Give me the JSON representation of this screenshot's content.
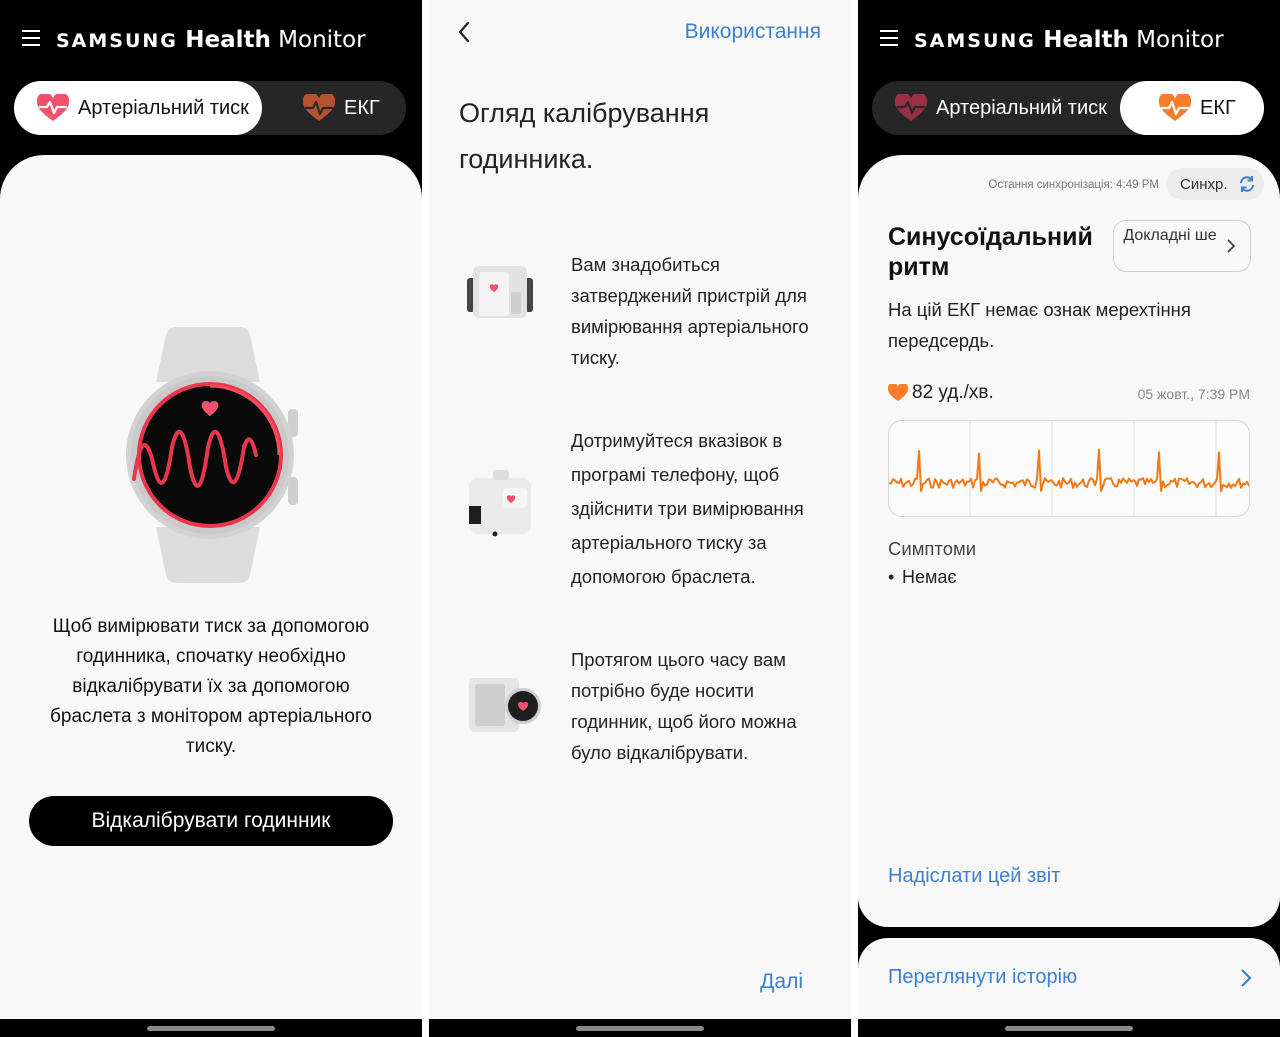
{
  "brand": {
    "part1": "SAMSUNG",
    "part2": "Health",
    "part3": "Monitor"
  },
  "tabs": {
    "bp": "Артеріальний тиск",
    "ecg": "ЕКГ"
  },
  "colors": {
    "link": "#3d7fd1",
    "ecg_line": "#f07a17",
    "heart": "#f26a4b"
  },
  "screen1": {
    "description": "Щоб вимірювати тиск за допомогою годинника, спочатку необхідно відкалібрувати їх за допомогою браслета з монітором артеріального тиску.",
    "calibrate_button": "Відкалібрувати годинник"
  },
  "screen2": {
    "top_link": "Використання",
    "title": "Огляд калібрування годинника.",
    "steps": [
      {
        "icon": "bp-monitor-icon",
        "text": "Вам знадобиться затверджений пристрій для вимірювання артеріального тиску."
      },
      {
        "icon": "phone-cuff-icon",
        "text": "Дотримуйтеся вказівок в програмі телефону, щоб здійснити три вимірювання артеріального тиску за допомогою браслета."
      },
      {
        "icon": "watch-calibration-icon",
        "text": "Протягом цього часу вам потрібно буде носити годинник, щоб його можна було відкалібрувати."
      }
    ],
    "next": "Далі"
  },
  "screen3": {
    "last_sync": "Остання синхронізація: 4:49 PM",
    "sync_button": "Синхр.",
    "result_title": "Синусоїдальний ритм",
    "details_button": "Докладні ше",
    "result_desc": "На цій ЕКГ немає ознак мерехтіння передсердь.",
    "bpm": "82 уд./хв.",
    "date": "05 жовт., 7:39 PM",
    "symptoms_title": "Симптоми",
    "symptom_item": "Немає",
    "send_report": "Надіслати цей звіт",
    "view_history": "Переглянути історію"
  }
}
